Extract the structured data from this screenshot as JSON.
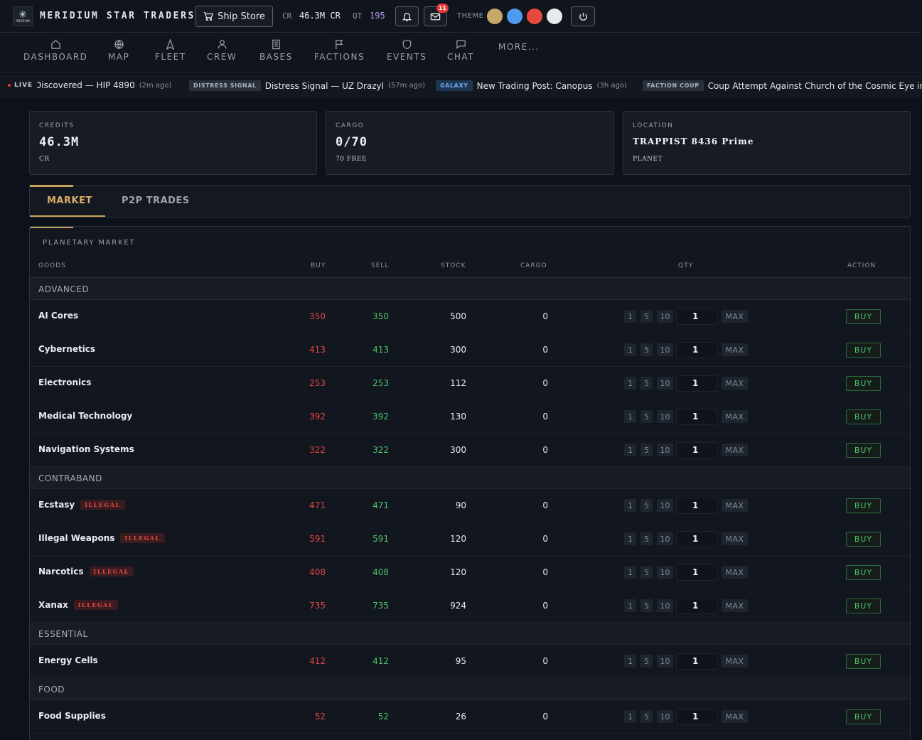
{
  "header": {
    "logo_text": "MERIDIUM",
    "brand": "MERIDIUM STAR TRADERS",
    "ship_store_label": "Ship Store",
    "cr_label": "CR",
    "cr_value": "46.3M CR",
    "qt_label": "QT",
    "qt_value": "195",
    "mail_badge": "11",
    "theme_label": "THEME",
    "theme_colors": [
      "#c8a869",
      "#4e9bf0",
      "#e8493f",
      "#e8eaee"
    ]
  },
  "nav": {
    "items": [
      {
        "label": "DASHBOARD",
        "icon": "home-icon"
      },
      {
        "label": "MAP",
        "icon": "globe-icon"
      },
      {
        "label": "FLEET",
        "icon": "ship-icon"
      },
      {
        "label": "CREW",
        "icon": "user-icon"
      },
      {
        "label": "BASES",
        "icon": "building-icon"
      },
      {
        "label": "FACTIONS",
        "icon": "flag-icon"
      },
      {
        "label": "EVENTS",
        "icon": "shield-icon"
      },
      {
        "label": "CHAT",
        "icon": "chat-icon"
      }
    ],
    "more_label": "MORE..."
  },
  "ticker": {
    "live_label": "LIVE",
    "items": [
      {
        "tag": "",
        "text": "Discovered — HIP 4890",
        "ago": "(2m ago)"
      },
      {
        "tag": "DISTRESS SIGNAL",
        "text": "Distress Signal — UZ Drazyl",
        "ago": "(57m ago)"
      },
      {
        "tag": "GALAXY",
        "text": "New Trading Post: Canopus",
        "ago": "(3h ago)"
      },
      {
        "tag": "FACTION COUP",
        "text": "Coup Attempt Against Church of the Cosmic Eye in A",
        "ago": ""
      }
    ]
  },
  "cards": {
    "credits": {
      "label": "CREDITS",
      "value": "46.3M",
      "sub": "CR"
    },
    "cargo": {
      "label": "CARGO",
      "value": "0/70",
      "sub": "70 FREE"
    },
    "location": {
      "label": "LOCATION",
      "value": "TRAPPIST 8436 Prime",
      "sub": "PLANET"
    }
  },
  "tabs": {
    "market": "MARKET",
    "p2p": "P2P TRADES"
  },
  "market": {
    "title": "PLANETARY MARKET",
    "columns": {
      "goods": "GOODS",
      "buy": "BUY",
      "sell": "SELL",
      "stock": "STOCK",
      "cargo": "CARGO",
      "qty": "QTY",
      "action": "ACTION"
    },
    "qty_buttons": [
      "1",
      "5",
      "10"
    ],
    "qty_default": "1",
    "max_label": "MAX",
    "buy_label": "BUY",
    "illegal_label": "ILLEGAL",
    "categories": [
      {
        "name": "ADVANCED",
        "goods": [
          {
            "name": "AI Cores",
            "buy": "350",
            "sell": "350",
            "stock": "500",
            "cargo": "0",
            "illegal": false
          },
          {
            "name": "Cybernetics",
            "buy": "413",
            "sell": "413",
            "stock": "300",
            "cargo": "0",
            "illegal": false
          },
          {
            "name": "Electronics",
            "buy": "253",
            "sell": "253",
            "stock": "112",
            "cargo": "0",
            "illegal": false
          },
          {
            "name": "Medical Technology",
            "buy": "392",
            "sell": "392",
            "stock": "130",
            "cargo": "0",
            "illegal": false
          },
          {
            "name": "Navigation Systems",
            "buy": "322",
            "sell": "322",
            "stock": "300",
            "cargo": "0",
            "illegal": false
          }
        ]
      },
      {
        "name": "CONTRABAND",
        "goods": [
          {
            "name": "Ecstasy",
            "buy": "471",
            "sell": "471",
            "stock": "90",
            "cargo": "0",
            "illegal": true
          },
          {
            "name": "Illegal Weapons",
            "buy": "591",
            "sell": "591",
            "stock": "120",
            "cargo": "0",
            "illegal": true
          },
          {
            "name": "Narcotics",
            "buy": "408",
            "sell": "408",
            "stock": "120",
            "cargo": "0",
            "illegal": true
          },
          {
            "name": "Xanax",
            "buy": "735",
            "sell": "735",
            "stock": "924",
            "cargo": "0",
            "illegal": true
          }
        ]
      },
      {
        "name": "ESSENTIAL",
        "goods": [
          {
            "name": "Energy Cells",
            "buy": "412",
            "sell": "412",
            "stock": "95",
            "cargo": "0",
            "illegal": false
          }
        ]
      },
      {
        "name": "FOOD",
        "goods": [
          {
            "name": "Food Supplies",
            "buy": "52",
            "sell": "52",
            "stock": "26",
            "cargo": "0",
            "illegal": false
          }
        ]
      }
    ]
  }
}
